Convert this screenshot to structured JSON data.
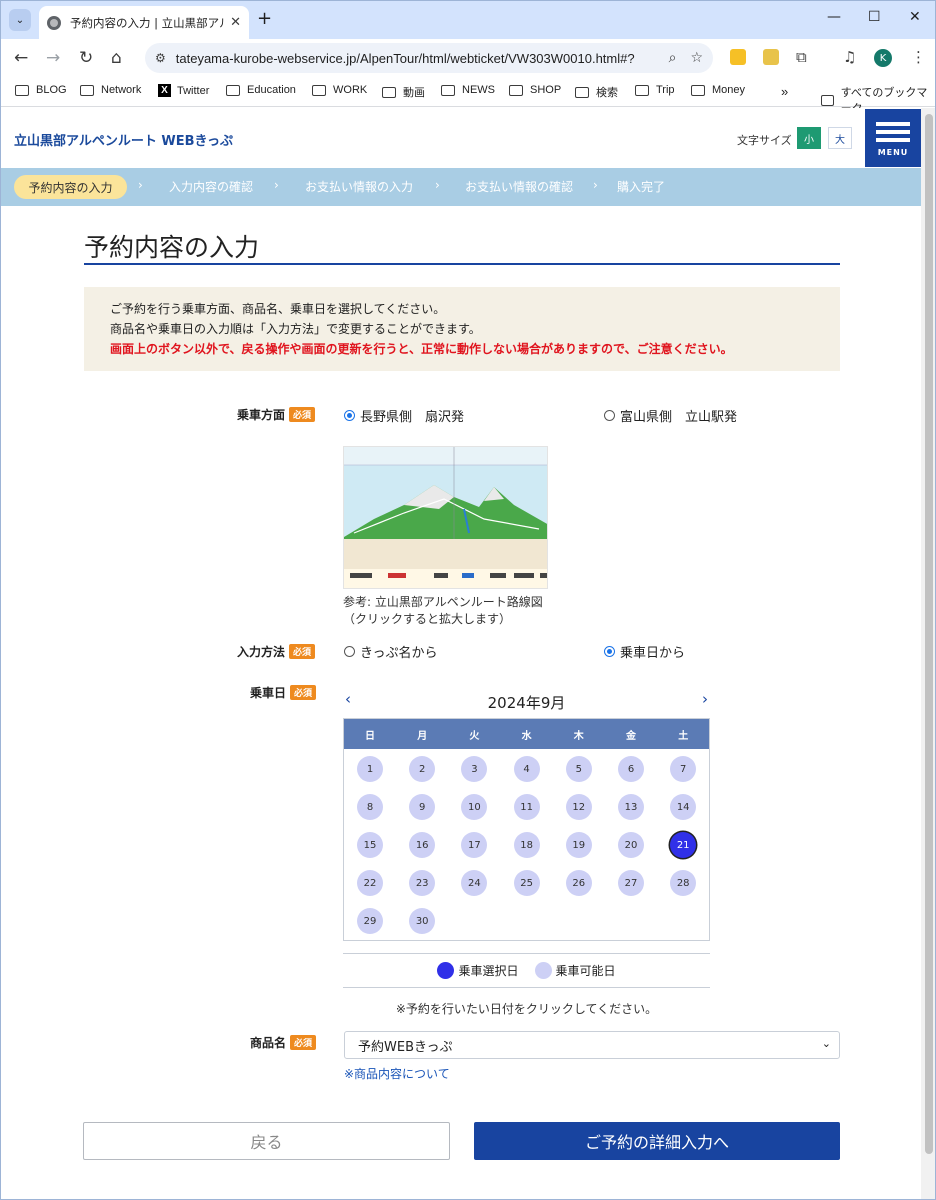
{
  "browser": {
    "tab_title": "予約内容の入力 | 立山黒部アルペ",
    "url": "tateyama-kurobe-webservice.jp/AlpenTour/html/webticket/VW303W0010.html#?",
    "bookmarks": [
      "BLOG",
      "Network",
      "Twitter",
      "Education",
      "WORK",
      "動画",
      "NEWS",
      "SHOP",
      "検索",
      "Trip",
      "Money"
    ],
    "all_bookmarks": "すべてのブックマーク",
    "avatar_initial": "K"
  },
  "header": {
    "site_title": "立山黒部アルペンルート WEBきっぷ",
    "font_size_label": "文字サイズ",
    "font_small": "小",
    "font_large": "大",
    "menu_label": "MENU"
  },
  "steps": [
    "予約内容の入力",
    "入力内容の確認",
    "お支払い情報の入力",
    "お支払い情報の確認",
    "購入完了"
  ],
  "page_title": "予約内容の入力",
  "notice": {
    "line1": "ご予約を行う乗車方面、商品名、乗車日を選択してください。",
    "line2": "商品名や乗車日の入力順は「入力方法」で変更することができます。",
    "warning": "画面上のボタン以外で、戻る操作や画面の更新を行うと、正常に動作しない場合がありますので、ご注意ください。"
  },
  "form": {
    "required_badge": "必須",
    "direction_label": "乗車方面",
    "direction_opt1": "長野県側　扇沢発",
    "direction_opt2": "富山県側　立山駅発",
    "map_caption1": "参考: 立山黒部アルペンルート路線図",
    "map_caption2": "（クリックすると拡大します）",
    "method_label": "入力方法",
    "method_opt1": "きっぷ名から",
    "method_opt2": "乗車日から",
    "date_label": "乗車日",
    "product_label": "商品名",
    "product_value": "予約WEBきっぷ",
    "product_link": "※商品内容について"
  },
  "calendar": {
    "prev": "‹",
    "next": "›",
    "month_title": "2024年9月",
    "weekdays": [
      "日",
      "月",
      "火",
      "水",
      "木",
      "金",
      "土"
    ],
    "days": [
      "1",
      "2",
      "3",
      "4",
      "5",
      "6",
      "7",
      "8",
      "9",
      "10",
      "11",
      "12",
      "13",
      "14",
      "15",
      "16",
      "17",
      "18",
      "19",
      "20",
      "21",
      "22",
      "23",
      "24",
      "25",
      "26",
      "27",
      "28",
      "29",
      "30"
    ],
    "selected_day": "21",
    "legend_selected": "乗車選択日",
    "legend_available": "乗車可能日",
    "hint": "※予約を行いたい日付をクリックしてください。",
    "colors": {
      "selected": "#3030e8",
      "available": "#cdd0f5"
    }
  },
  "buttons": {
    "back": "戻る",
    "next": "ご予約の詳細入力へ"
  }
}
